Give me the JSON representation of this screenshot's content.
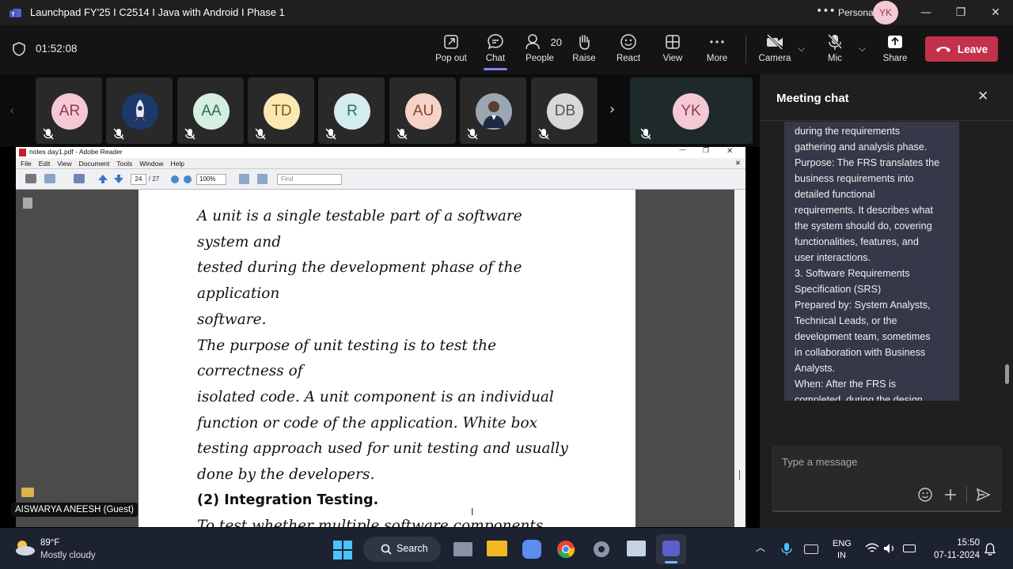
{
  "window": {
    "title": "Launchpad FY'25 I C2514 I Java with Android I Phase 1",
    "profile_label": "Personal",
    "profile_initials": "YK"
  },
  "meeting": {
    "timer": "01:52:08",
    "toolbar": [
      {
        "label": "Pop out",
        "icon": "pop-out-icon"
      },
      {
        "label": "Chat",
        "icon": "chat-icon"
      },
      {
        "label": "People",
        "icon": "people-icon"
      },
      {
        "label": "Raise",
        "icon": "raise-hand-icon"
      },
      {
        "label": "React",
        "icon": "react-icon"
      },
      {
        "label": "View",
        "icon": "view-grid-icon"
      },
      {
        "label": "More",
        "icon": "more-icon"
      }
    ],
    "people_count": "20",
    "camera_label": "Camera",
    "mic_label": "Mic",
    "share_label": "Share",
    "leave_label": "Leave",
    "leave_color": "#c4314b"
  },
  "participants": [
    {
      "initials": "AR",
      "bg": "#f4c9d3",
      "fg": "#8a3a54"
    },
    {
      "initials": "",
      "bg": "#1b3a6b",
      "fg": "#fff",
      "kind": "rocket"
    },
    {
      "initials": "AA",
      "bg": "#d4efdf",
      "fg": "#2e6b4b"
    },
    {
      "initials": "TD",
      "bg": "#fbe7b2",
      "fg": "#7a5a16"
    },
    {
      "initials": "R",
      "bg": "#d2ecef",
      "fg": "#2c6a72"
    },
    {
      "initials": "AU",
      "bg": "#f6d3c7",
      "fg": "#8a3f2a"
    },
    {
      "initials": "",
      "bg": "#7a8a9a",
      "fg": "#fff",
      "kind": "photo"
    },
    {
      "initials": "DB",
      "bg": "#d8d8d8",
      "fg": "#555"
    }
  ],
  "self_participant": {
    "initials": "YK",
    "bg": "#f4c9d3",
    "fg": "#8a3a54"
  },
  "presenter_label": "AISWARYA ANEESH (Guest)",
  "pdf": {
    "window_title": "notes day1.pdf - Adobe Reader",
    "menu": [
      "File",
      "Edit",
      "View",
      "Document",
      "Tools",
      "Window",
      "Help"
    ],
    "page_current": "24",
    "page_total": "/ 27",
    "zoom": "100%",
    "find_placeholder": "Find",
    "lines": [
      "A unit is a single testable part of a software",
      "system and",
      "tested during the development phase of the",
      "application",
      "software.",
      "The purpose of unit testing is to test the",
      "correctness of",
      "isolated code. A unit component is an individual",
      "function or code of the application. White box",
      "testing approach used for unit testing and usually",
      "done by the developers.",
      "(2) Integration Testing.",
      "To test whether multiple software components"
    ]
  },
  "chat": {
    "title": "Meeting chat",
    "lines": [
      "during the requirements",
      "gathering and analysis phase.",
      "Purpose: The FRS translates the",
      "business requirements into",
      "detailed functional",
      "requirements. It describes what",
      "the system should do, covering",
      "functionalities, features, and",
      "user interactions.",
      "3. Software Requirements",
      "Specification (SRS)",
      "Prepared by: System Analysts,",
      "Technical Leads, or the",
      "development team, sometimes",
      "in collaboration with Business",
      "Analysts.",
      "When: After the FRS is",
      "completed, during the design"
    ],
    "input_placeholder": "Type a message"
  },
  "taskbar": {
    "weather_temp": "89°F",
    "weather_desc": "Mostly cloudy",
    "search_label": "Search",
    "lang_top": "ENG",
    "lang_bottom": "IN",
    "time": "15:50",
    "date": "07-11-2024"
  }
}
